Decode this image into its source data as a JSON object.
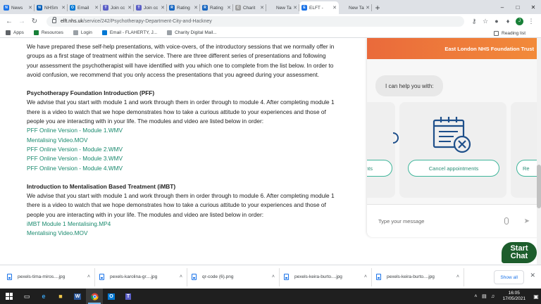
{
  "browser": {
    "tabs": [
      {
        "title": "News",
        "color": "#1a73e8",
        "glyph": "N"
      },
      {
        "title": "NHSm",
        "color": "#005eb8",
        "glyph": "N"
      },
      {
        "title": "Email",
        "color": "#0078d4",
        "glyph": "O"
      },
      {
        "title": "Join cc",
        "color": "#5b5fc7",
        "glyph": "T"
      },
      {
        "title": "Join cc",
        "color": "#5b5fc7",
        "glyph": "T"
      },
      {
        "title": "Rating",
        "color": "#1565c0",
        "glyph": "R"
      },
      {
        "title": "Rating",
        "color": "#1565c0",
        "glyph": "R"
      },
      {
        "title": "Charit",
        "color": "#9e9e9e",
        "glyph": "C"
      },
      {
        "title": "New Tab",
        "color": "#dee1e6",
        "glyph": ""
      },
      {
        "title": "ELFT -",
        "color": "#1a73e8",
        "glyph": "E",
        "active": true
      },
      {
        "title": "New Tab",
        "color": "#dee1e6",
        "glyph": ""
      }
    ],
    "new_tab_symbol": "+",
    "url_domain": "elft.nhs.uk",
    "url_path": "/service/242/Psychotherapy-Department-City-and-Hackney",
    "profile_initial": "J",
    "bookmarks": [
      {
        "label": "Apps",
        "color": "#5f6368"
      },
      {
        "label": "Resources",
        "color": "#188038"
      },
      {
        "label": "Login",
        "color": "#9aa0a6"
      },
      {
        "label": "Email - FLAHERTY, J...",
        "color": "#0078d4"
      },
      {
        "label": "Charity Digital Mail...",
        "color": "#9aa0a6"
      }
    ],
    "reading_list": "Reading list"
  },
  "article": {
    "intro": "We have prepared these self-help presentations, with voice-overs, of the introductory sessions that we normally offer in groups as a first stage of treatment within the service. There are three different series of presentations and following your assessment the psychotherapist will have identified with you which one to complete from the list below. In order to avoid confusion, we recommend that you only access the presentations that you agreed during your assessment.",
    "section1_heading": "Psychotherapy Foundation Introduction (PFF)",
    "section1_text": "We advise that you start with module 1 and work through them in order through to module 4. After completing module 1 there is a video to watch that we hope demonstrates how to take a curious attitude to your experiences and those of people you are interacting with in your life. The modules and video are listed below in order:",
    "section1_links": [
      "PFF Online Version - Module 1.WMV",
      "Mentalising Video.MOV",
      "PFF Online Version - Module 2.WMV",
      "PFF Online Version - Module 3.WMV",
      "PFF Online Version - Module 4.WMV"
    ],
    "section2_heading": "Introduction to Mentalisation Based Treatment (iMBT)",
    "section2_text": "We advise that you start with module 1 and work through them in order through to module 6. After completing module 1 there is a video to watch that we hope demonstrates how to take a curious attitude to your experiences and those of people you are interacting with in your life. The modules and video are listed below in order:",
    "section2_links": [
      "iMBT Module 1 Mentalising.MP4",
      "Mentalising Video.MOV"
    ]
  },
  "chat": {
    "header": "East London NHS Foundation Trust",
    "prompt": "I can help you with:",
    "left_option": "nts",
    "middle_option": "Cancel appointments",
    "right_option": "Re",
    "input_placeholder": "Type your message",
    "start_chat_line1": "Start",
    "start_chat_line2": "Chat",
    "accent_color": "#3fb59a",
    "header_color": "#ea6a3b"
  },
  "downloads": {
    "items": [
      "pexels-tima-miros....jpg",
      "pexels-karolina-gr....jpg",
      "qr-code (6).png",
      "pexels-keira-burto....jpg",
      "pexels-keira-burto....jpg"
    ],
    "show_all": "Show all"
  },
  "taskbar": {
    "time": "16:05",
    "date": "17/05/2021"
  }
}
